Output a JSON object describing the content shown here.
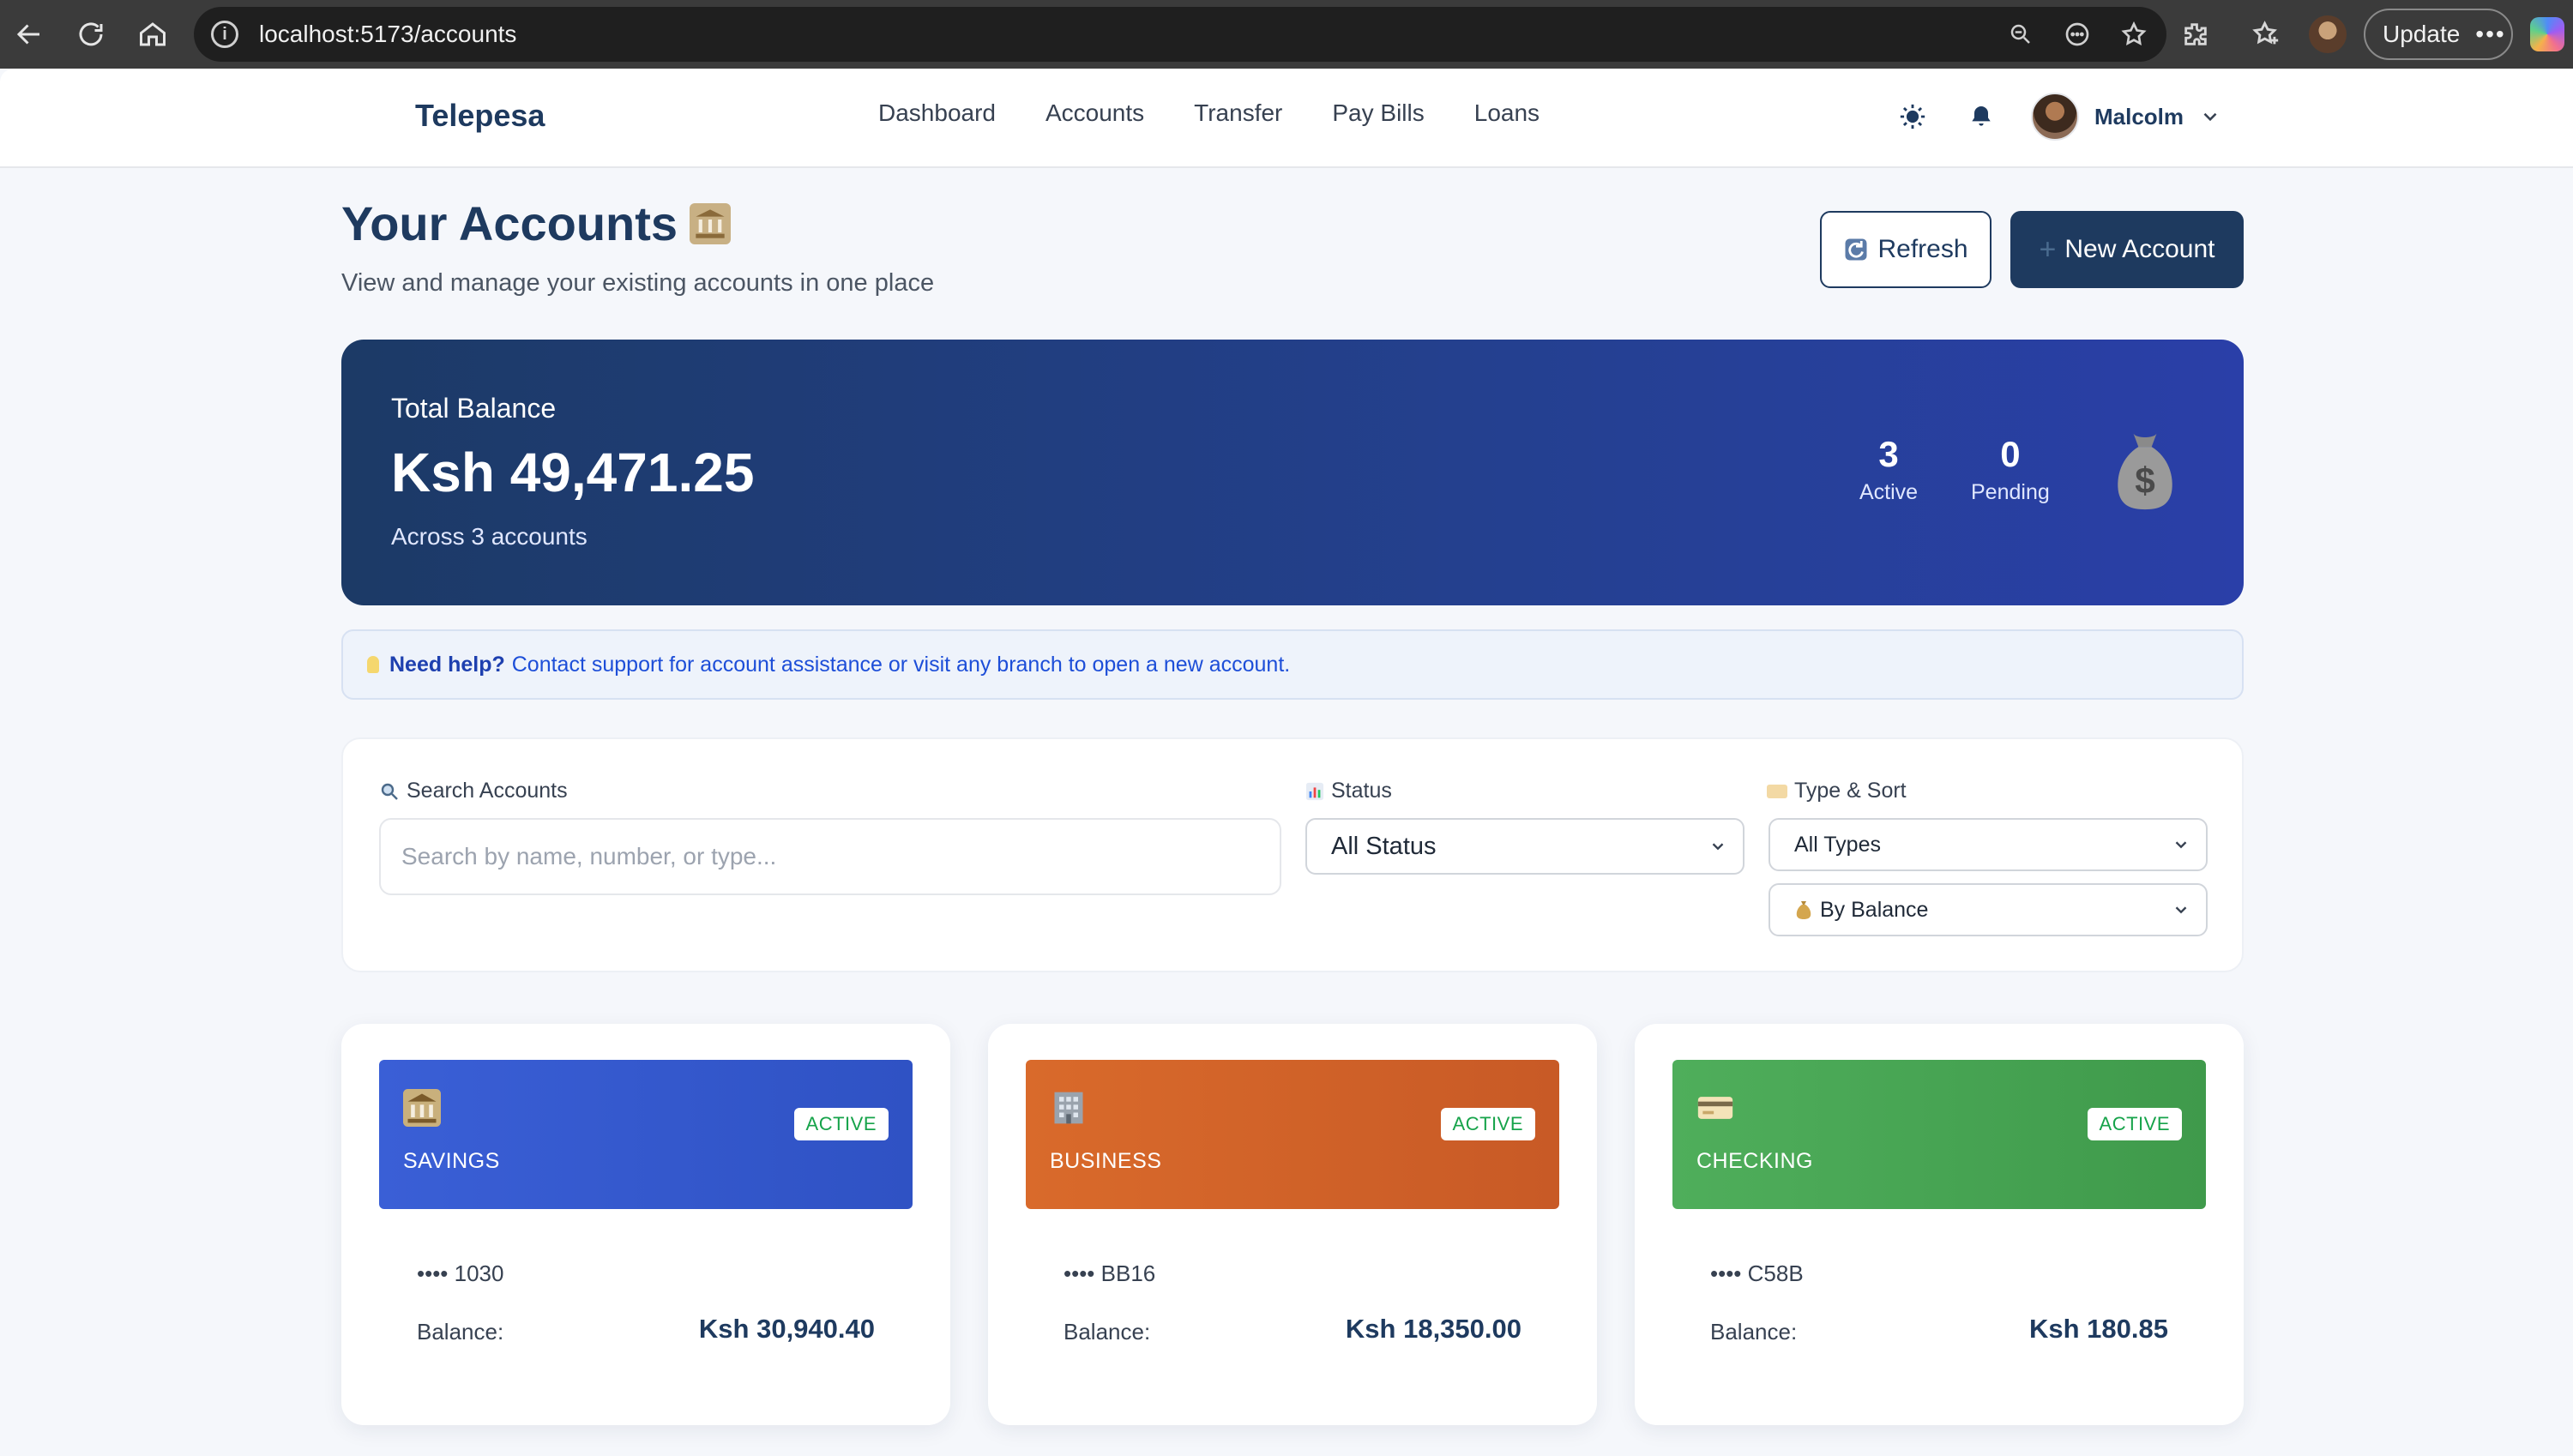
{
  "browser": {
    "url": "localhost:5173/accounts",
    "update_label": "Update"
  },
  "nav": {
    "brand": "Telepesa",
    "menu": [
      "Dashboard",
      "Accounts",
      "Transfer",
      "Pay Bills",
      "Loans"
    ],
    "user_name": "Malcolm"
  },
  "header": {
    "title": "Your Accounts",
    "subtitle": "View and manage your existing accounts in one place",
    "refresh_label": "Refresh",
    "new_account_label": "New Account"
  },
  "summary": {
    "label": "Total Balance",
    "amount": "Ksh 49,471.25",
    "sub": "Across 3 accounts",
    "active_count": "3",
    "active_label": "Active",
    "pending_count": "0",
    "pending_label": "Pending"
  },
  "help": {
    "bold": "Need help?",
    "text": "Contact support for account assistance or visit any branch to open a new account."
  },
  "filters": {
    "search_label": "Search Accounts",
    "search_placeholder": "Search by name, number, or type...",
    "status_label": "Status",
    "status_value": "All Status",
    "type_sort_label": "Type & Sort",
    "type_value": "All Types",
    "sort_value": "By Balance"
  },
  "accounts": [
    {
      "type": "SAVINGS",
      "status": "ACTIVE",
      "number": "•••• 1030",
      "balance_label": "Balance:",
      "balance": "Ksh 30,940.40",
      "color": "#3358d4"
    },
    {
      "type": "BUSINESS",
      "status": "ACTIVE",
      "number": "•••• BB16",
      "balance_label": "Balance:",
      "balance": "Ksh 18,350.00",
      "color": "#d2652a"
    },
    {
      "type": "CHECKING",
      "status": "ACTIVE",
      "number": "•••• C58B",
      "balance_label": "Balance:",
      "balance": "Ksh 180.85",
      "color": "#44a552"
    }
  ],
  "colors": {
    "primary": "#1e3a5f",
    "success": "#16a34a",
    "link": "#1d4ed8"
  }
}
